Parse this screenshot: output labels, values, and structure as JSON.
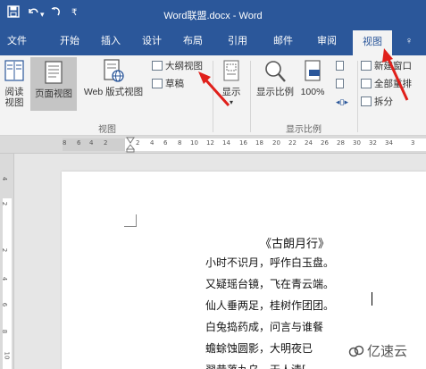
{
  "titlebar": {
    "save_icon": "save-icon",
    "undo_icon": "undo-icon",
    "redo_icon": "redo-icon",
    "customize_icon": "customize-icon",
    "title": "Word联盟.docx - Word"
  },
  "tabs": [
    {
      "label": "文件"
    },
    {
      "label": "开始"
    },
    {
      "label": "插入"
    },
    {
      "label": "设计"
    },
    {
      "label": "布局"
    },
    {
      "label": "引用"
    },
    {
      "label": "邮件"
    },
    {
      "label": "审阅"
    },
    {
      "label": "视图",
      "active": true
    },
    {
      "label": "♀"
    }
  ],
  "ribbon": {
    "views": {
      "read_mode": "阅读\n视图",
      "print_layout": "页面视图",
      "web_layout": "Web 版式视图",
      "outline": "大纲视图",
      "draft": "草稿",
      "group_label": "视图"
    },
    "show": {
      "label": "显示"
    },
    "zoom": {
      "zoom": "显示比例",
      "percent": "100%",
      "group_label": "显示比例"
    },
    "window": {
      "new_window": "新建窗口",
      "arrange_all": "全部重排",
      "split": "拆分"
    }
  },
  "ruler": {
    "corner": "L",
    "ticks": [
      "8",
      "6",
      "4",
      "2",
      "2",
      "4",
      "6",
      "8",
      "10",
      "12",
      "14",
      "16",
      "18",
      "20",
      "22",
      "24",
      "26",
      "28",
      "30",
      "32",
      "34",
      "3"
    ],
    "vticks": [
      "4",
      "2",
      "2",
      "4",
      "6",
      "8",
      "10"
    ]
  },
  "document": {
    "title": "《古朗月行》",
    "lines": [
      "小时不识月，呼作白玉盘。",
      "又疑瑶台镜，飞在青云端。",
      "仙人垂两足，桂树作团团。",
      "白兔捣药成，问言与谁餐",
      "蟾蜍蚀圆影，大明夜已",
      "羿昔落九乌，天人清["
    ]
  },
  "watermark": {
    "text": "亿速云"
  },
  "colors": {
    "accent": "#2b579a",
    "annotation": "#e0201b"
  }
}
